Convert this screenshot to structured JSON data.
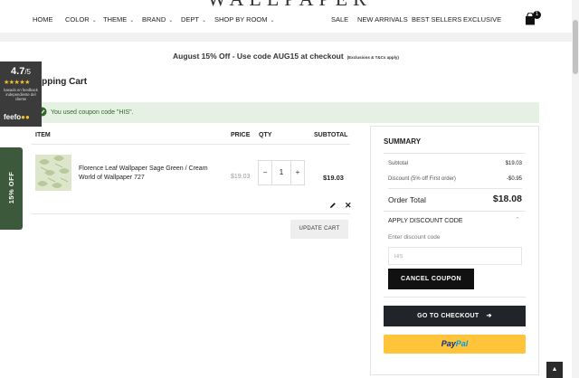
{
  "header": {
    "logo_text": "WALLPAPER",
    "nav": [
      {
        "label": "HOME"
      },
      {
        "label": "COLOR"
      },
      {
        "label": "THEME"
      },
      {
        "label": "BRAND"
      },
      {
        "label": "DEPT"
      },
      {
        "label": "SHOP BY ROOM"
      },
      {
        "label": "SALE"
      },
      {
        "label": "NEW ARRIVALS"
      },
      {
        "label": "BEST SELLERS"
      },
      {
        "label": "EXCLUSIVE"
      }
    ],
    "cart_count": "1",
    "cart_icon": "shopping-bag-icon"
  },
  "promo": {
    "text": "August 15% Off - Use code AUG15 at checkout",
    "fine_print": "(Exclusions & T&Cs apply)"
  },
  "page": {
    "title": "Shopping Cart",
    "title_visible": "opping Cart"
  },
  "coupon_message": {
    "text": "You used coupon code \"HIS\".",
    "color": "#e5f1e3"
  },
  "cart": {
    "columns": {
      "item": "ITEM",
      "price": "PRICE",
      "qty": "QTY",
      "subtotal": "SUBTOTAL"
    },
    "items": [
      {
        "name": "Florence Leaf Wallpaper Sage Green / Cream World of Wallpaper 727",
        "price": "$19.03",
        "qty": "1",
        "subtotal": "$19.03"
      }
    ],
    "minus": "−",
    "plus": "+",
    "update_label": "UPDATE CART"
  },
  "summary": {
    "title": "SUMMARY",
    "subtotal_label": "Subtotal",
    "subtotal_value": "$19.03",
    "discount_label": "Discount (5% off First order)",
    "discount_value": "-$0.95",
    "total_label": "Order Total",
    "total_value": "$18.08",
    "apply_discount_label": "APPLY DISCOUNT CODE",
    "discount_code_label": "Enter discount code",
    "discount_code_value": "HIS",
    "cancel_coupon_label": "CANCEL COUPON",
    "checkout_label": "GO TO CHECKOUT",
    "paypal_part1": "Pay",
    "paypal_part2": "Pal"
  },
  "feefo": {
    "score": "4.7",
    "out_of": "/5",
    "stars": "★★★★★",
    "caption": "basado en feedback independiente del cliente",
    "brand": "feefo"
  },
  "side_tab": {
    "label": "15% OFF",
    "color": "#3c5a3b"
  }
}
